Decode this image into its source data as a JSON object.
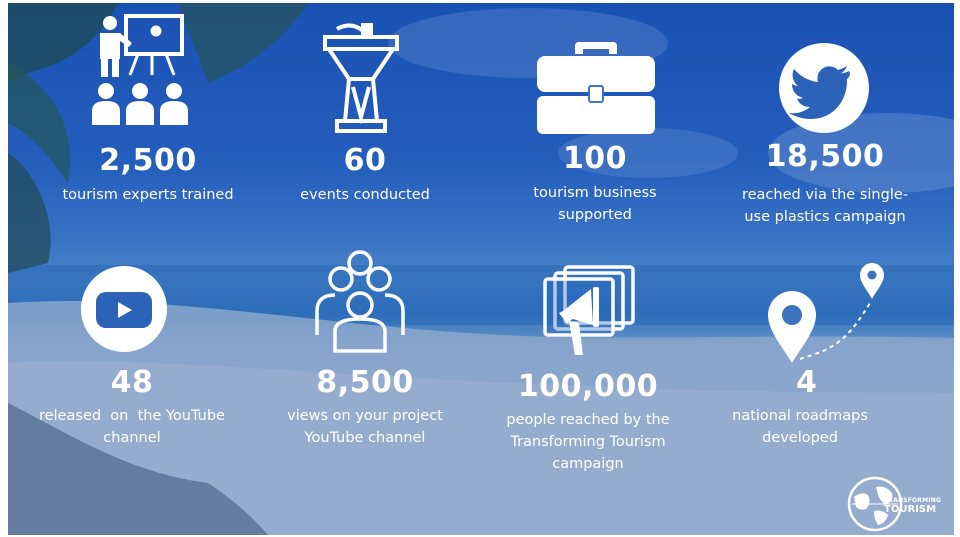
{
  "stats": [
    {
      "value": "2,500",
      "caption_lines": [
        "tourism experts trained"
      ],
      "icon": "presentation-trainer-icon"
    },
    {
      "value": "60",
      "caption_lines": [
        "events conducted"
      ],
      "icon": "podium-icon"
    },
    {
      "value": "100",
      "caption_lines": [
        "tourism business",
        "supported"
      ],
      "icon": "briefcase-icon"
    },
    {
      "value": "18,500",
      "caption_lines": [
        "reached via the single-",
        "use plastics campaign"
      ],
      "icon": "twitter-bird-icon"
    },
    {
      "value": "48",
      "caption_lines": [
        "released  on  the YouTube",
        "channel"
      ],
      "icon": "youtube-play-icon"
    },
    {
      "value": "8,500",
      "caption_lines": [
        "views on your project",
        "YouTube channel"
      ],
      "icon": "people-group-icon"
    },
    {
      "value": "100,000",
      "caption_lines": [
        "people reached by the",
        "Transforming Tourism",
        "campaign"
      ],
      "icon": "megaphone-screen-icon"
    },
    {
      "value": "4",
      "caption_lines": [
        "national roadmaps",
        "developed"
      ],
      "icon": "map-route-pins-icon"
    }
  ],
  "logo": {
    "line1": "TRANSFORMING",
    "line2": "TOURISM",
    "icon": "globe-logo-icon"
  },
  "colors": {
    "text": "#ffffff",
    "sky": "#2a68c4",
    "sea": "#3f86c8",
    "sand": "#c4d5de"
  }
}
